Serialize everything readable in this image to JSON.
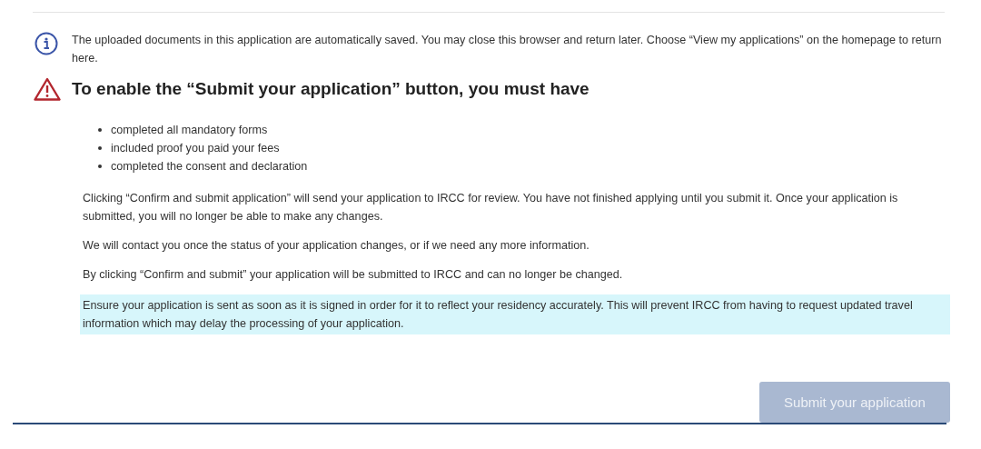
{
  "info_notice": "The uploaded documents in this application are automatically saved. You may close this browser and return later. Choose “View my applications” on the homepage to return here.",
  "warning_heading": "To enable the “Submit your application” button, you must have",
  "requirements": [
    "completed all mandatory forms",
    "included proof you paid your fees",
    "completed the consent and declaration"
  ],
  "paragraphs": [
    {
      "kind": "plain",
      "text": "Clicking “Confirm and submit application” will send your application to IRCC for review. You have not finished applying until you submit it. Once your application is submitted, you will no longer be able to make any changes."
    },
    {
      "kind": "plain",
      "text": "We will contact you once the status of your application changes, or if we need any more information."
    },
    {
      "kind": "plain",
      "text": "By clicking “Confirm and submit” your application will be submitted to IRCC and can no longer be changed."
    },
    {
      "kind": "highlight",
      "text": "Ensure your application is sent as soon as it is signed in order for it to reflect your residency accurately. This will prevent IRCC from having to request updated travel information which may delay the processing of your application."
    }
  ],
  "submit_button": {
    "label": "Submit your application",
    "disabled": true
  }
}
